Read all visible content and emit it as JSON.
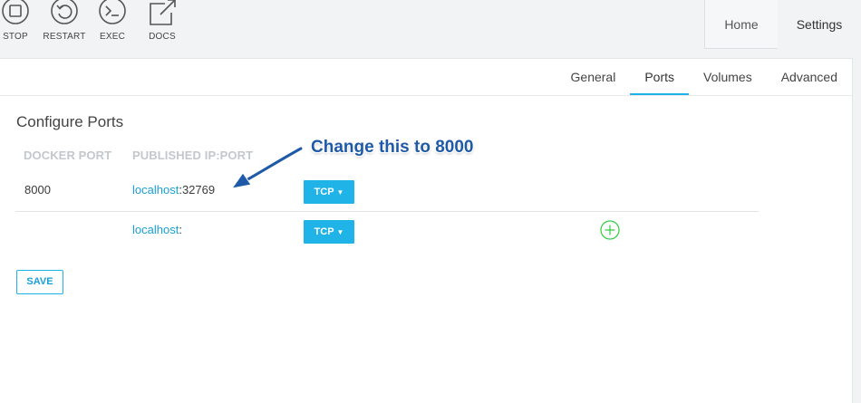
{
  "toolbar": {
    "stop_label": "STOP",
    "restart_label": "RESTART",
    "exec_label": "EXEC",
    "docs_label": "DOCS"
  },
  "nav": {
    "home_label": "Home",
    "settings_label": "Settings"
  },
  "subtabs": [
    "General",
    "Ports",
    "Volumes",
    "Advanced"
  ],
  "active_subtab": "Ports",
  "page": {
    "title": "Configure Ports",
    "col_docker_port": "DOCKER PORT",
    "col_published": "PUBLISHED IP:PORT"
  },
  "ports": [
    {
      "docker_port": "8000",
      "host": "localhost",
      "sep": ":",
      "published_port": "32769",
      "protocol": "TCP"
    },
    {
      "docker_port": "",
      "host": "localhost",
      "sep": ":",
      "published_port": "",
      "protocol": "TCP"
    }
  ],
  "save_label": "SAVE",
  "annotation": "Change this to 8000",
  "colors": {
    "accent": "#1fb3e8",
    "link": "#1a9fd4",
    "add": "#2ecc40",
    "annotation": "#1e5aa8"
  }
}
